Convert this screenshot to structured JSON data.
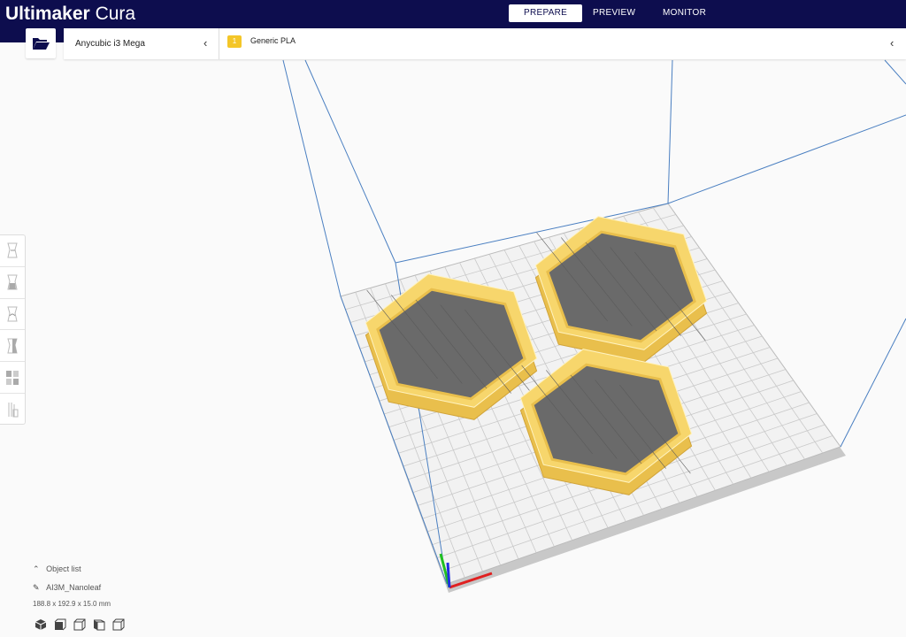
{
  "header": {
    "brand_bold": "Ultimaker",
    "brand_light": "Cura",
    "stages": [
      {
        "label": "PREPARE",
        "active": true
      },
      {
        "label": "PREVIEW",
        "active": false
      },
      {
        "label": "MONITOR",
        "active": false
      }
    ]
  },
  "printer": {
    "name": "Anycubic i3 Mega"
  },
  "material": {
    "extruder_number": "1",
    "name": "Generic PLA"
  },
  "tools": [
    "move-tool",
    "scale-tool",
    "rotate-tool",
    "mirror-tool",
    "per-model-settings-tool",
    "support-blocker-tool"
  ],
  "object_panel": {
    "toggle_label": "Object list",
    "object_name": "AI3M_Nanoleaf",
    "dimensions": "188.8 x 192.9 x 15.0 mm"
  },
  "view_buttons": [
    "3d-view",
    "front-view",
    "top-view",
    "left-view",
    "right-view"
  ],
  "colors": {
    "header": "#0d0d4e",
    "model": "#f7d66c",
    "model_floor": "#6a6a6a",
    "badge": "#f4c628",
    "volume_lines": "#4a7fc1"
  }
}
